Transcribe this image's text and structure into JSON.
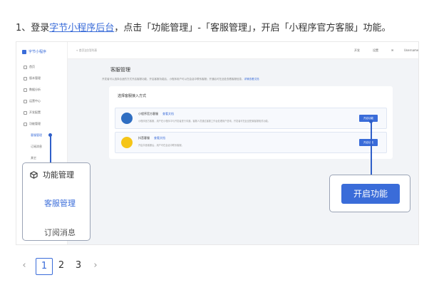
{
  "step": {
    "prefix": "1、登录",
    "link": "字节小程序后台",
    "suffix": "，点击「功能管理」-「客服管理」，开启「小程序官方客服」功能。"
  },
  "app": {
    "logo": "字节小程序",
    "breadcrumb": "« 首页|应用列表",
    "top_right": [
      "开发",
      "设置",
      "✉",
      "Username"
    ],
    "sidebar": [
      {
        "label": "首页"
      },
      {
        "label": "版本管理"
      },
      {
        "label": "数据分析"
      },
      {
        "label": "运营中心"
      },
      {
        "label": "开发配置"
      },
      {
        "label": "功能管理"
      },
      {
        "label": "客服管理"
      },
      {
        "label": "订阅消息"
      },
      {
        "label": "其它"
      }
    ]
  },
  "page": {
    "title": "客服管理",
    "desc": "开发者可以选择合适的方式开启客服功能，开启客服功能后，小程序用户可以在会话中联系客服；开通后可在此处查看客服信息，",
    "desc_link": "详情查看文档",
    "card_title": "选择客服接入方式",
    "services": [
      {
        "name": "小程序官方客服",
        "tag": "查看文档",
        "desc": "小程序官方客服，用户在小程序中与开发者进行沟通，客服人员通过客服工作台处理用户咨询，开发者可在此处配置客服相关功能。",
        "button": "开启功能",
        "color": "#2f6ec2"
      },
      {
        "name": "抖音客服",
        "tag": "查看文档",
        "desc": "开启抖音客服后，用户可在会话中联系客服。",
        "button": "开启功能",
        "color": "#f5c518"
      }
    ]
  },
  "zoom_left": {
    "header": "功能管理",
    "selected": "客服管理",
    "other": "订阅消息"
  },
  "zoom_right": {
    "button": "开启功能"
  },
  "pagination": {
    "prev": "‹",
    "pages": [
      "1",
      "2",
      "3"
    ],
    "current": "1",
    "next": "›"
  },
  "colors": {
    "accent": "#3a6cd9"
  }
}
